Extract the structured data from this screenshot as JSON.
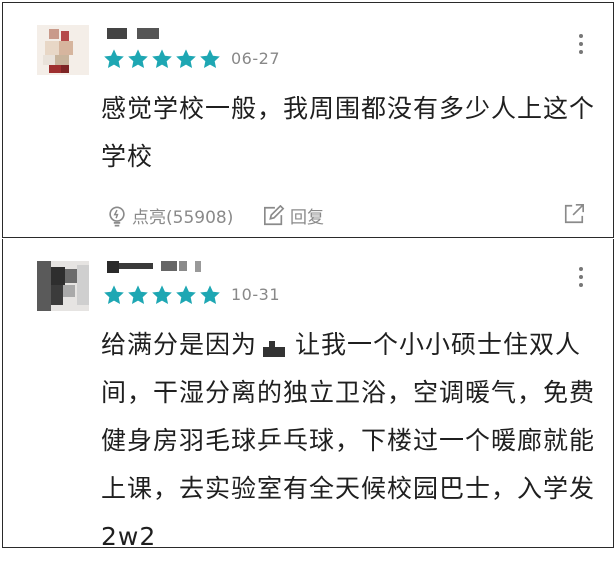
{
  "reviews": [
    {
      "rating": 5,
      "date": "06-27",
      "content_lines": [
        "感觉学校一般，我周围都没有多少人上这个",
        "学校"
      ],
      "like_label": "点亮(55908)",
      "reply_label": "回复",
      "star_color": "#1ea7b3"
    },
    {
      "rating": 5,
      "date": "10-31",
      "content_line1_a": "给满分是因为",
      "content_line1_b": "让我一个小小硕士住双人",
      "content_lines_rest": [
        "间，干湿分离的独立卫浴，空调暖气，免费",
        "健身房羽毛球乒乓球，下楼过一个暖廊就能",
        "上课，去实验室有全天候校园巴士，入学发",
        "2w2"
      ],
      "star_color": "#1ea7b3"
    }
  ]
}
